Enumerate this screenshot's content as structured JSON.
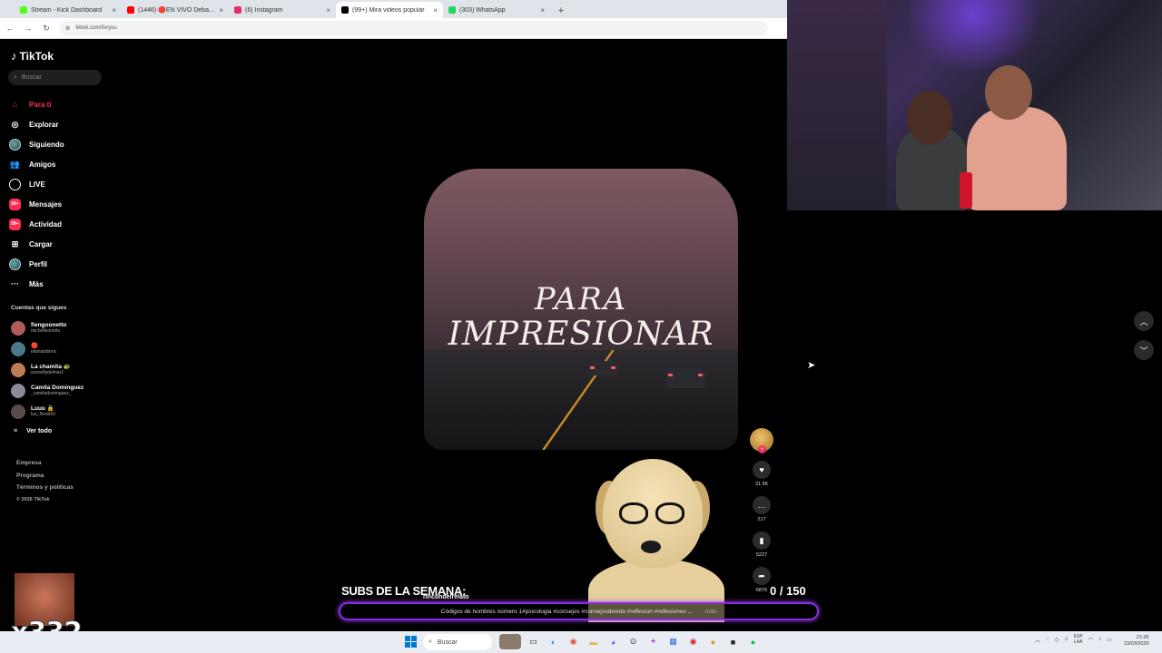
{
  "browser": {
    "tabs": [
      {
        "label": "Stream - Kick Dashboard",
        "color": "#53fc18",
        "active": false
      },
      {
        "label": "(1446) 🔴EN VIVO Debate presi",
        "color": "#ff0000",
        "active": false
      },
      {
        "label": "(6) Instagram",
        "color": "#e1306c",
        "active": false
      },
      {
        "label": "(99+) Mira videos popular",
        "color": "#000000",
        "active": true
      },
      {
        "label": "(303) WhatsApp",
        "color": "#25d366",
        "active": false
      }
    ],
    "url": "tiktok.com/foryou"
  },
  "sidebar": {
    "logo": "TikTok",
    "search_placeholder": "Buscar",
    "nav": [
      {
        "label": "Para ti",
        "icon": "home-icon",
        "glyph": "⌂"
      },
      {
        "label": "Explorar",
        "icon": "compass-icon",
        "glyph": "◎"
      },
      {
        "label": "Siguiendo",
        "icon": "following-icon",
        "glyph": ""
      },
      {
        "label": "Amigos",
        "icon": "friends-icon",
        "glyph": "👥"
      },
      {
        "label": "LIVE",
        "icon": "live-icon",
        "glyph": ""
      },
      {
        "label": "Mensajes",
        "icon": "messages-icon",
        "glyph": "99+"
      },
      {
        "label": "Actividad",
        "icon": "activity-icon",
        "glyph": "99+"
      },
      {
        "label": "Cargar",
        "icon": "upload-icon",
        "glyph": "⊞"
      },
      {
        "label": "Perfil",
        "icon": "profile-icon",
        "glyph": ""
      },
      {
        "label": "Más",
        "icon": "more-icon",
        "glyph": "···"
      }
    ],
    "following_title": "Cuentas que sigues",
    "following": [
      {
        "name": "fiengoonetto",
        "handle": "michelleonetto",
        "color": "#b05a5a"
      },
      {
        "name": "🔴",
        "handle": "elianatobonc",
        "color": "#4a7a88"
      },
      {
        "name": "La chamita 🐢",
        "handle": "yosnellydelmar1",
        "color": "#c07a55"
      },
      {
        "name": "Camila Domínguez",
        "handle": "_camiladominguez_",
        "color": "#8a8a98"
      },
      {
        "name": "Luuu 🔒",
        "handle": "luu_fioroitch",
        "color": "#5a4a4a"
      }
    ],
    "see_all": "Ver todo",
    "footer": [
      "Empresa",
      "Programa",
      "Términos y políticas"
    ],
    "copyright": "© 2026 TikTok"
  },
  "video": {
    "title_line1": "PARA",
    "title_line2": "IMPRESIONAR",
    "author": "rincondelrelato",
    "caption": "Códigos de hombres número 1#psicologia #consejos #consejosdevida #reflexion #reflexiones ...",
    "more": "más"
  },
  "actions": {
    "likes": "31.5K",
    "comments": "217",
    "saves": "5227",
    "shares": "6876"
  },
  "overlay": {
    "subs_title": "SUBS DE LA SEMANA:",
    "subs_count": "0  / 150",
    "emote_count": "x332"
  },
  "taskbar": {
    "search": "Buscar",
    "lang_top": "ESP",
    "lang_bottom": "LAA",
    "time": "21:35",
    "date": "23/03/2026"
  }
}
